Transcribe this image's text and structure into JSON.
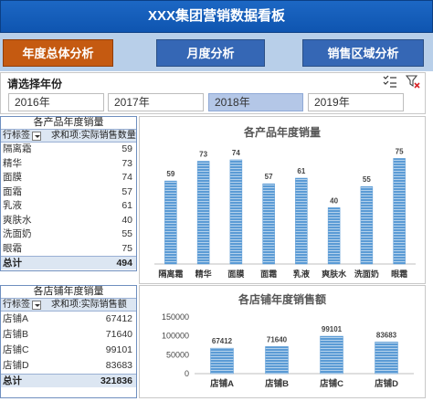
{
  "header": {
    "title": "XXX集团营销数据看板"
  },
  "nav": {
    "annual": "年度总体分析",
    "yearly": "月度分析",
    "region": "销售区域分析"
  },
  "slicer": {
    "title": "请选择年份",
    "years": [
      {
        "label": "2016年",
        "selected": false
      },
      {
        "label": "2017年",
        "selected": false
      },
      {
        "label": "2018年",
        "selected": true
      },
      {
        "label": "2019年",
        "selected": false
      }
    ]
  },
  "pivot_products": {
    "title": "各产品年度销量",
    "row_label": "行标签",
    "value_label": "求和项:实际销售数量",
    "rows": [
      {
        "name": "隔离霜",
        "value": "59"
      },
      {
        "name": "精华",
        "value": "73"
      },
      {
        "name": "面膜",
        "value": "74"
      },
      {
        "name": "面霜",
        "value": "57"
      },
      {
        "name": "乳液",
        "value": "61"
      },
      {
        "name": "爽肤水",
        "value": "40"
      },
      {
        "name": "洗面奶",
        "value": "55"
      },
      {
        "name": "眼霜",
        "value": "75"
      }
    ],
    "total_label": "总计",
    "total_value": "494"
  },
  "pivot_stores": {
    "title": "各店铺年度销量",
    "row_label": "行标签",
    "value_label": "求和项:实际销售额",
    "rows": [
      {
        "name": "店铺A",
        "value": "67412"
      },
      {
        "name": "店铺B",
        "value": "71640"
      },
      {
        "name": "店铺C",
        "value": "99101"
      },
      {
        "name": "店铺D",
        "value": "83683"
      }
    ],
    "total_label": "总计",
    "total_value": "321836"
  },
  "colors": {
    "bar": "#5b9bd5",
    "accent": "#c55a11",
    "nav": "#3567b5",
    "title": "#0f55b0"
  },
  "chart_data": [
    {
      "type": "bar",
      "title": "各产品年度销量",
      "categories": [
        "隔离霜",
        "精华",
        "面膜",
        "面霜",
        "乳液",
        "爽肤水",
        "洗面奶",
        "眼霜"
      ],
      "values": [
        59,
        73,
        74,
        57,
        61,
        40,
        55,
        75
      ],
      "ylim": [
        0,
        85
      ],
      "grid": false,
      "legend": "none"
    },
    {
      "type": "bar",
      "title": "各店铺年度销售额",
      "categories": [
        "店铺A",
        "店铺B",
        "店铺C",
        "店铺D"
      ],
      "values": [
        67412,
        71640,
        99101,
        83683
      ],
      "yticks": [
        "0",
        "50000",
        "100000",
        "150000"
      ],
      "ylim": [
        0,
        150000
      ],
      "grid": false,
      "legend": "none"
    }
  ]
}
